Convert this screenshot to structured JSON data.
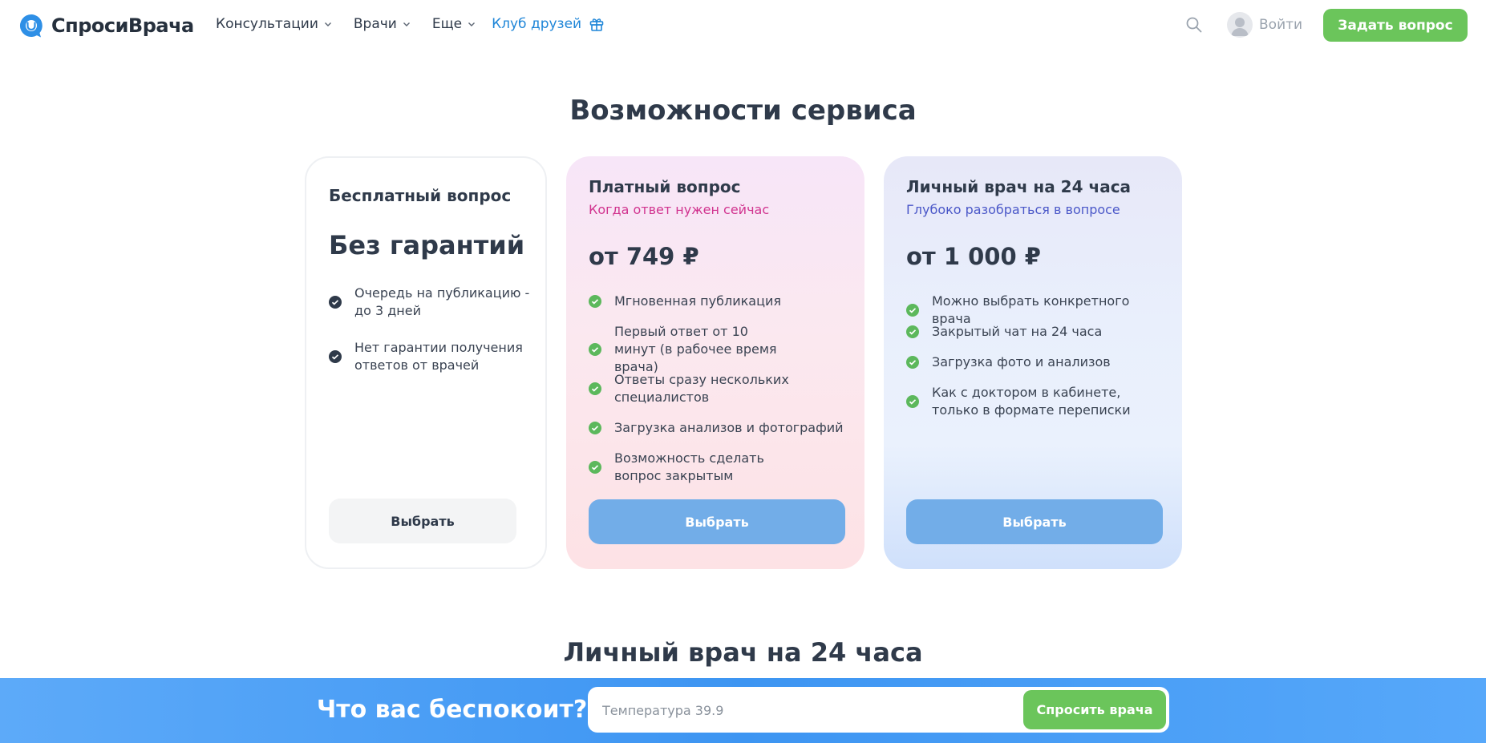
{
  "header": {
    "logo_text": "СпросиВрача",
    "nav": [
      {
        "label": "Консультации",
        "icon": "chevron-down-icon"
      },
      {
        "label": "Врачи",
        "icon": "chevron-down-icon"
      },
      {
        "label": "Еще",
        "icon": "chevron-down-icon"
      }
    ],
    "club_label": "Клуб друзей",
    "login_label": "Войти",
    "ask_button": "Задать вопрос"
  },
  "section_title": "Возможности сервиса",
  "cards": {
    "free": {
      "title": "Бесплатный вопрос",
      "price": "Без гарантий",
      "features": [
        "Очередь на публикацию - до 3 дней",
        "Нет гарантии получения ответов от врачей"
      ],
      "button": "Выбрать"
    },
    "paid": {
      "title": "Платный вопрос",
      "subtitle": "Когда ответ нужен сейчас",
      "price": "от 749 ₽",
      "features": [
        "Мгновенная публикация",
        "Первый ответ от 10 минут (в рабочее время врача)",
        "Ответы сразу нескольких специалистов",
        "Загрузка анализов и фотографий",
        "Возможность сделать вопрос закрытым"
      ],
      "button": "Выбрать"
    },
    "personal": {
      "title": "Личный врач на 24 часа",
      "subtitle": "Глубоко разобраться в вопросе",
      "price": "от 1 000 ₽",
      "features": [
        "Можно выбрать конкретного врача",
        "Закрытый чат на 24 часа",
        "Загрузка фото и анализов",
        "Как с доктором в кабинете, только в формате переписки"
      ],
      "button": "Выбрать"
    }
  },
  "second_section_title": "Личный врач на 24 часа",
  "bottom_bar": {
    "title": "Что вас беспокоит?",
    "input_placeholder": "Температура 39.9",
    "button": "Спросить врача"
  },
  "colors": {
    "primary_green": "#6bc55b",
    "link_blue": "#1f86d8",
    "paid_accent": "#d1338f",
    "personal_accent": "#4a57c8",
    "select_blue": "#72ade8"
  }
}
